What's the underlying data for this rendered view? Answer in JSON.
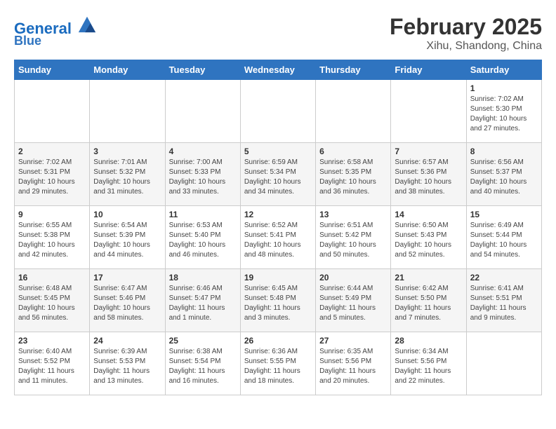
{
  "header": {
    "logo_line1": "General",
    "logo_line2": "Blue",
    "month": "February 2025",
    "location": "Xihu, Shandong, China"
  },
  "weekdays": [
    "Sunday",
    "Monday",
    "Tuesday",
    "Wednesday",
    "Thursday",
    "Friday",
    "Saturday"
  ],
  "weeks": [
    [
      {
        "day": "",
        "info": ""
      },
      {
        "day": "",
        "info": ""
      },
      {
        "day": "",
        "info": ""
      },
      {
        "day": "",
        "info": ""
      },
      {
        "day": "",
        "info": ""
      },
      {
        "day": "",
        "info": ""
      },
      {
        "day": "1",
        "info": "Sunrise: 7:02 AM\nSunset: 5:30 PM\nDaylight: 10 hours and 27 minutes."
      }
    ],
    [
      {
        "day": "2",
        "info": "Sunrise: 7:02 AM\nSunset: 5:31 PM\nDaylight: 10 hours and 29 minutes."
      },
      {
        "day": "3",
        "info": "Sunrise: 7:01 AM\nSunset: 5:32 PM\nDaylight: 10 hours and 31 minutes."
      },
      {
        "day": "4",
        "info": "Sunrise: 7:00 AM\nSunset: 5:33 PM\nDaylight: 10 hours and 33 minutes."
      },
      {
        "day": "5",
        "info": "Sunrise: 6:59 AM\nSunset: 5:34 PM\nDaylight: 10 hours and 34 minutes."
      },
      {
        "day": "6",
        "info": "Sunrise: 6:58 AM\nSunset: 5:35 PM\nDaylight: 10 hours and 36 minutes."
      },
      {
        "day": "7",
        "info": "Sunrise: 6:57 AM\nSunset: 5:36 PM\nDaylight: 10 hours and 38 minutes."
      },
      {
        "day": "8",
        "info": "Sunrise: 6:56 AM\nSunset: 5:37 PM\nDaylight: 10 hours and 40 minutes."
      }
    ],
    [
      {
        "day": "9",
        "info": "Sunrise: 6:55 AM\nSunset: 5:38 PM\nDaylight: 10 hours and 42 minutes."
      },
      {
        "day": "10",
        "info": "Sunrise: 6:54 AM\nSunset: 5:39 PM\nDaylight: 10 hours and 44 minutes."
      },
      {
        "day": "11",
        "info": "Sunrise: 6:53 AM\nSunset: 5:40 PM\nDaylight: 10 hours and 46 minutes."
      },
      {
        "day": "12",
        "info": "Sunrise: 6:52 AM\nSunset: 5:41 PM\nDaylight: 10 hours and 48 minutes."
      },
      {
        "day": "13",
        "info": "Sunrise: 6:51 AM\nSunset: 5:42 PM\nDaylight: 10 hours and 50 minutes."
      },
      {
        "day": "14",
        "info": "Sunrise: 6:50 AM\nSunset: 5:43 PM\nDaylight: 10 hours and 52 minutes."
      },
      {
        "day": "15",
        "info": "Sunrise: 6:49 AM\nSunset: 5:44 PM\nDaylight: 10 hours and 54 minutes."
      }
    ],
    [
      {
        "day": "16",
        "info": "Sunrise: 6:48 AM\nSunset: 5:45 PM\nDaylight: 10 hours and 56 minutes."
      },
      {
        "day": "17",
        "info": "Sunrise: 6:47 AM\nSunset: 5:46 PM\nDaylight: 10 hours and 58 minutes."
      },
      {
        "day": "18",
        "info": "Sunrise: 6:46 AM\nSunset: 5:47 PM\nDaylight: 11 hours and 1 minute."
      },
      {
        "day": "19",
        "info": "Sunrise: 6:45 AM\nSunset: 5:48 PM\nDaylight: 11 hours and 3 minutes."
      },
      {
        "day": "20",
        "info": "Sunrise: 6:44 AM\nSunset: 5:49 PM\nDaylight: 11 hours and 5 minutes."
      },
      {
        "day": "21",
        "info": "Sunrise: 6:42 AM\nSunset: 5:50 PM\nDaylight: 11 hours and 7 minutes."
      },
      {
        "day": "22",
        "info": "Sunrise: 6:41 AM\nSunset: 5:51 PM\nDaylight: 11 hours and 9 minutes."
      }
    ],
    [
      {
        "day": "23",
        "info": "Sunrise: 6:40 AM\nSunset: 5:52 PM\nDaylight: 11 hours and 11 minutes."
      },
      {
        "day": "24",
        "info": "Sunrise: 6:39 AM\nSunset: 5:53 PM\nDaylight: 11 hours and 13 minutes."
      },
      {
        "day": "25",
        "info": "Sunrise: 6:38 AM\nSunset: 5:54 PM\nDaylight: 11 hours and 16 minutes."
      },
      {
        "day": "26",
        "info": "Sunrise: 6:36 AM\nSunset: 5:55 PM\nDaylight: 11 hours and 18 minutes."
      },
      {
        "day": "27",
        "info": "Sunrise: 6:35 AM\nSunset: 5:56 PM\nDaylight: 11 hours and 20 minutes."
      },
      {
        "day": "28",
        "info": "Sunrise: 6:34 AM\nSunset: 5:56 PM\nDaylight: 11 hours and 22 minutes."
      },
      {
        "day": "",
        "info": ""
      }
    ]
  ]
}
